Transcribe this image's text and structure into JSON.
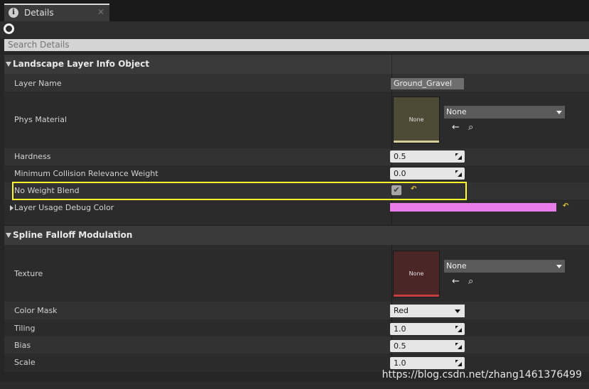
{
  "tab": {
    "label": "Details",
    "close": "✕",
    "icon": "info-icon"
  },
  "search": {
    "placeholder": "Search Details"
  },
  "sections": {
    "layer_info": {
      "title": "Landscape Layer Info Object",
      "layer_name": {
        "label": "Layer Name",
        "value": "Ground_Gravel"
      },
      "phys_material": {
        "label": "Phys Material",
        "thumb": "None",
        "combo": "None",
        "thumb_color": "#4d4a36",
        "bar_color": "#d6ce9a"
      },
      "hardness": {
        "label": "Hardness",
        "value": "0.5"
      },
      "min_collision": {
        "label": "Minimum Collision Relevance Weight",
        "value": "0.0"
      },
      "no_weight_blend": {
        "label": "No Weight Blend",
        "checked": true,
        "check": "✔",
        "reset": "↶"
      },
      "debug_color": {
        "label": "Layer Usage Debug Color",
        "color": "#e87ce8",
        "reset": "↶"
      }
    },
    "spline": {
      "title": "Spline Falloff Modulation",
      "texture": {
        "label": "Texture",
        "thumb": "None",
        "combo": "None",
        "thumb_color": "#4a2626",
        "bar_color": "#c44040"
      },
      "color_mask": {
        "label": "Color Mask",
        "value": "Red"
      },
      "tiling": {
        "label": "Tiling",
        "value": "1.0"
      },
      "bias": {
        "label": "Bias",
        "value": "0.5"
      },
      "scale": {
        "label": "Scale",
        "value": "1.0"
      }
    }
  },
  "asset_icons": {
    "use": "←",
    "browse": "⌕"
  },
  "watermark": "https://blog.csdn.net/zhang1461376499",
  "colors": {
    "highlight": "#ffff2a",
    "panel": "#262626"
  }
}
